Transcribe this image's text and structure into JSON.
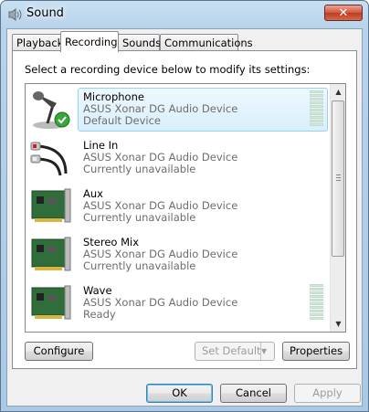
{
  "window": {
    "title": "Sound",
    "close_glyph": "✕"
  },
  "tabs": [
    {
      "label": "Playback",
      "active": false
    },
    {
      "label": "Recording",
      "active": true
    },
    {
      "label": "Sounds",
      "active": false
    },
    {
      "label": "Communications",
      "active": false
    }
  ],
  "recording": {
    "instruction": "Select a recording device below to modify its settings:",
    "devices": [
      {
        "name": "Microphone",
        "driver": "ASUS Xonar DG Audio Device",
        "status": "Default Device",
        "icon": "microphone-icon",
        "selected": true,
        "default": true
      },
      {
        "name": "Line In",
        "driver": "ASUS Xonar DG Audio Device",
        "status": "Currently unavailable",
        "icon": "line-in-cable-icon",
        "selected": false
      },
      {
        "name": "Aux",
        "driver": "ASUS Xonar DG Audio Device",
        "status": "Currently unavailable",
        "icon": "sound-card-icon",
        "selected": false
      },
      {
        "name": "Stereo Mix",
        "driver": "ASUS Xonar DG Audio Device",
        "status": "Currently unavailable",
        "icon": "sound-card-icon",
        "selected": false
      },
      {
        "name": "Wave",
        "driver": "ASUS Xonar DG Audio Device",
        "status": "Ready",
        "icon": "sound-card-icon",
        "selected": false
      }
    ],
    "buttons": {
      "configure": "Configure",
      "set_default": "Set Default",
      "properties": "Properties"
    }
  },
  "dialog_buttons": {
    "ok": "OK",
    "cancel": "Cancel",
    "apply": "Apply"
  },
  "colors": {
    "selection_border": "#99d1ef",
    "check_green": "#3aa63a",
    "close_red": "#c23a20"
  }
}
